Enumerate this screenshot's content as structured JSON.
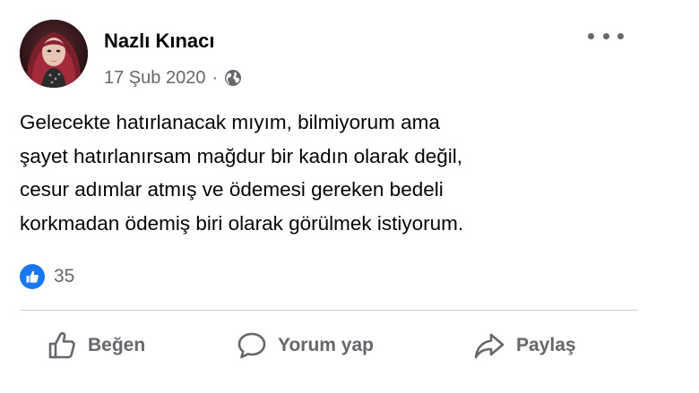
{
  "post": {
    "author": "Nazlı Kınacı",
    "date": "17 Şub 2020",
    "separator": "·",
    "privacy_icon": "globe-icon",
    "more_icon": "more-options-icon",
    "text_lines": [
      "Gelecekte hatırlanacak mıyım, bilmiyorum ama",
      "şayet hatırlanırsam mağdur bir kadın olarak değil,",
      "cesur adımlar atmış ve ödemesi gereken bedeli",
      "korkmadan ödemiş biri olarak görülmek istiyorum."
    ]
  },
  "reactions": {
    "icon": "like-reaction-icon",
    "count": "35"
  },
  "actions": {
    "like_label": "Beğen",
    "comment_label": "Yorum yap",
    "share_label": "Paylaş"
  },
  "colors": {
    "text_primary": "#050505",
    "text_secondary": "#65676b",
    "like_blue": "#1877f2",
    "divider": "#ced0d4"
  }
}
